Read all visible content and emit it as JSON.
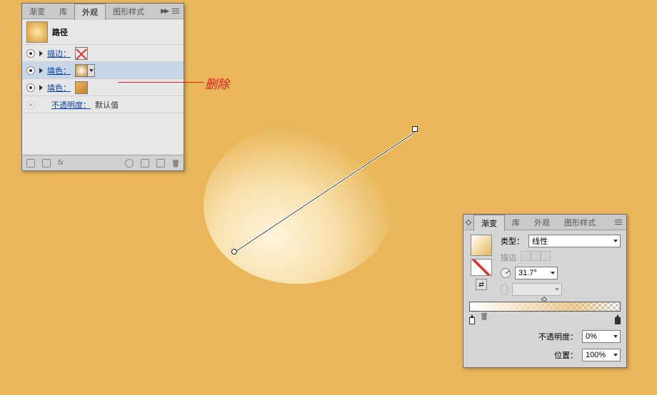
{
  "appearance_panel": {
    "tabs": [
      "渐变",
      "库",
      "外观",
      "图形样式"
    ],
    "active_tab_index": 2,
    "header_label": "路径",
    "rows": [
      {
        "label": "描边："
      },
      {
        "label": "填色："
      },
      {
        "label": "填色："
      }
    ],
    "opacity_row": {
      "label": "不透明度：",
      "value": "默认值"
    },
    "fx_label": "fx"
  },
  "annotation": {
    "text": "删除"
  },
  "gradient_panel": {
    "tabs": [
      "渐变",
      "库",
      "外观",
      "图形样式"
    ],
    "active_tab_index": 0,
    "type_label": "类型：",
    "type_value": "线性",
    "stroke_label": "描边",
    "angle_value": "31.7°",
    "opacity_label": "不透明度：",
    "opacity_value": "0%",
    "location_label": "位置：",
    "location_value": "100%"
  }
}
